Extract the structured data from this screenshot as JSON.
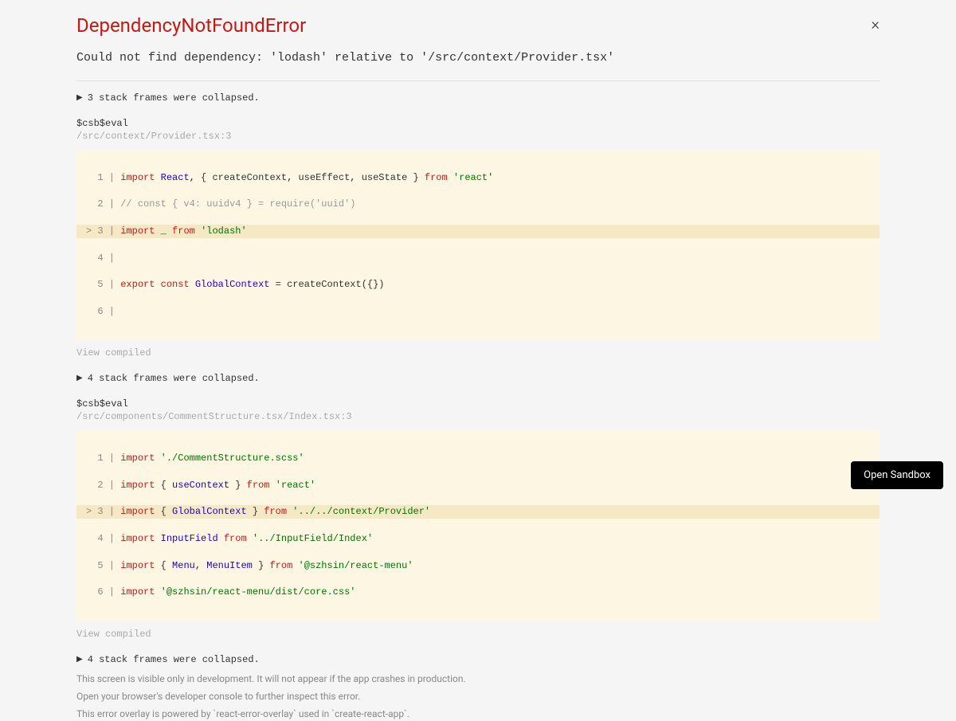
{
  "error": {
    "title": "DependencyNotFoundError",
    "message": "Could not find dependency: 'lodash' relative to '/src/context/Provider.tsx'"
  },
  "close_label": "×",
  "collapse1": "3 stack frames were collapsed.",
  "collapse2": "4 stack frames were collapsed.",
  "collapse3": "4 stack frames were collapsed.",
  "frame1": {
    "label": "$csb$eval",
    "path": "/src/context/Provider.tsx:3",
    "lines": {
      "l1_no": "  1 | ",
      "l1_import": "import",
      "l1_react": " React",
      "l1_rest1": ", { createContext, useEffect, useState } ",
      "l1_from": "from",
      "l1_sp": " ",
      "l1_str": "'react'",
      "l2_no": "  2 | ",
      "l2_txt": "// const { v4: uuidv4 } = require('uuid')",
      "l3_no": "> 3 | ",
      "l3_import": "import",
      "l3_sp1": " _ ",
      "l3_from": "from",
      "l3_sp2": " ",
      "l3_str": "'lodash'",
      "l4_no": "  4 | ",
      "l5_no": "  5 | ",
      "l5_export": "export",
      "l5_sp1": " ",
      "l5_const": "const",
      "l5_sp2": " ",
      "l5_gc": "GlobalContext",
      "l5_rest": " = createContext({})",
      "l6_no": "  6 | "
    }
  },
  "frame2": {
    "label": "$csb$eval",
    "path": "/src/components/CommentStructure.tsx/Index.tsx:3",
    "lines": {
      "l1_no": "  1 | ",
      "l1_import": "import",
      "l1_sp": " ",
      "l1_str": "'./CommentStructure.scss'",
      "l2_no": "  2 | ",
      "l2_import": "import",
      "l2_sp1": " { ",
      "l2_uc": "useContext",
      "l2_sp2": " } ",
      "l2_from": "from",
      "l2_sp3": " ",
      "l2_str": "'react'",
      "l3_no": "> 3 | ",
      "l3_import": "import",
      "l3_sp1": " { ",
      "l3_gc": "GlobalContext",
      "l3_sp2": " } ",
      "l3_from": "from",
      "l3_sp3": " ",
      "l3_str": "'../../context/Provider'",
      "l4_no": "  4 | ",
      "l4_import": "import",
      "l4_sp1": " ",
      "l4_if": "InputField",
      "l4_sp2": " ",
      "l4_from": "from",
      "l4_sp3": " ",
      "l4_str": "'../InputField/Index'",
      "l5_no": "  5 | ",
      "l5_import": "import",
      "l5_sp1": " { ",
      "l5_menu": "Menu",
      "l5_comma": ", ",
      "l5_mi": "MenuItem",
      "l5_sp2": " } ",
      "l5_from": "from",
      "l5_sp3": " ",
      "l5_str": "'@szhsin/react-menu'",
      "l6_no": "  6 | ",
      "l6_import": "import",
      "l6_sp": " ",
      "l6_str": "'@szhsin/react-menu/dist/core.css'"
    }
  },
  "view_compiled": "View compiled",
  "footer": {
    "l1": "This screen is visible only in development. It will not appear if the app crashes in production.",
    "l2": "Open your browser's developer console to further inspect this error.",
    "l3": "This error overlay is powered by `react-error-overlay` used in `create-react-app`."
  },
  "open_sandbox": "Open Sandbox"
}
